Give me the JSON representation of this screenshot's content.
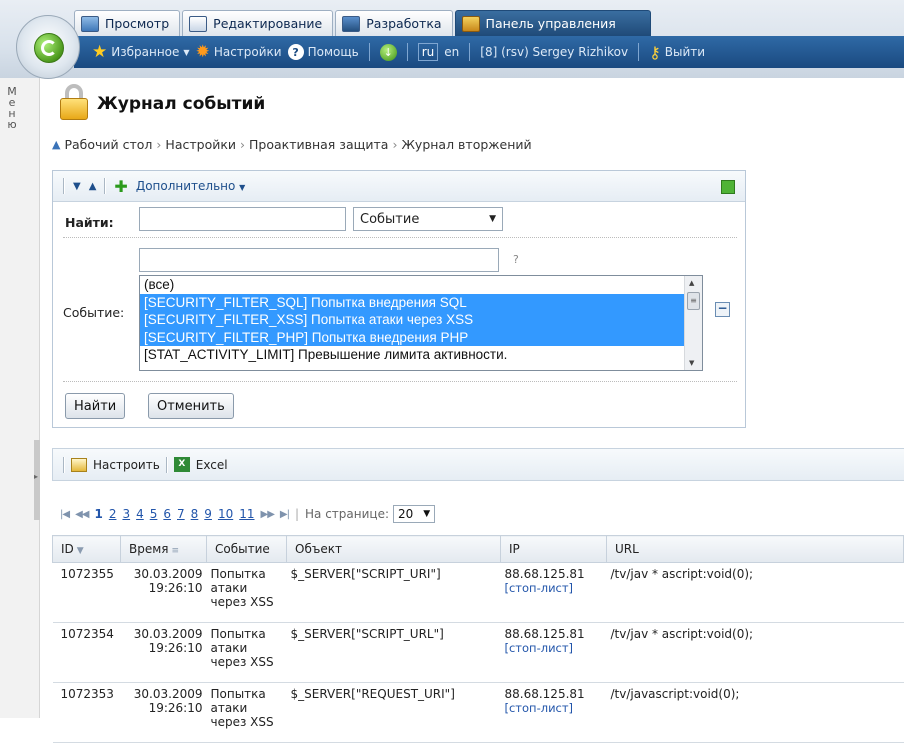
{
  "tabs": [
    {
      "label": "Просмотр",
      "icon": "view-icon"
    },
    {
      "label": "Редактирование",
      "icon": "edit-icon"
    },
    {
      "label": "Разработка",
      "icon": "develop-icon"
    },
    {
      "label": "Панель управления",
      "icon": "control-panel-icon"
    }
  ],
  "toolbar": {
    "favorites": "Избранное",
    "settings": "Настройки",
    "help": "Помощь",
    "lang_ru": "ru",
    "lang_en": "en",
    "user": "[8] (rsv) Sergey Rizhikov",
    "logout": "Выйти"
  },
  "side_menu": [
    "М",
    "е",
    "н",
    "ю"
  ],
  "page": {
    "title": "Журнал событий",
    "breadcrumb": [
      "Рабочий стол",
      "Настройки",
      "Проактивная защита",
      "Журнал вторжений"
    ]
  },
  "filter": {
    "more": "Дополнительно",
    "find_label": "Найти:",
    "find_value": "",
    "find_select": "Событие",
    "question": "?",
    "event_label": "Событие:",
    "options": [
      {
        "text": "(все)",
        "selected": false
      },
      {
        "text": "[SECURITY_FILTER_SQL] Попытка внедрения SQL",
        "selected": true
      },
      {
        "text": "[SECURITY_FILTER_XSS] Попытка атаки через XSS",
        "selected": true
      },
      {
        "text": "[SECURITY_FILTER_PHP] Попытка внедрения PHP",
        "selected": true
      },
      {
        "text": "[STAT_ACTIVITY_LIMIT] Превышение лимита активности.",
        "selected": false
      }
    ],
    "find_button": "Найти",
    "cancel_button": "Отменить"
  },
  "list_toolbar": {
    "configure": "Настроить",
    "excel": "Excel"
  },
  "pager": {
    "pages": [
      "1",
      "2",
      "3",
      "4",
      "5",
      "6",
      "7",
      "8",
      "9",
      "10",
      "11"
    ],
    "current": "1",
    "per_page_label": "На странице:",
    "per_page": "20"
  },
  "table": {
    "columns": [
      "ID",
      "Время",
      "Событие",
      "Объект",
      "IP",
      "URL"
    ],
    "rows": [
      {
        "id": "1072355",
        "date": "30.03.2009",
        "time": "19:26:10",
        "event": [
          "Попытка",
          "атаки",
          "через XSS"
        ],
        "object": "$_SERVER[\"SCRIPT_URI\"]",
        "ip": "88.68.125.81",
        "stop": "[стоп-лист]",
        "url": "/tv/jav * ascript:void(0);"
      },
      {
        "id": "1072354",
        "date": "30.03.2009",
        "time": "19:26:10",
        "event": [
          "Попытка",
          "атаки",
          "через XSS"
        ],
        "object": "$_SERVER[\"SCRIPT_URL\"]",
        "ip": "88.68.125.81",
        "stop": "[стоп-лист]",
        "url": "/tv/jav * ascript:void(0);"
      },
      {
        "id": "1072353",
        "date": "30.03.2009",
        "time": "19:26:10",
        "event": [
          "Попытка",
          "атаки",
          "через XSS"
        ],
        "object": "$_SERVER[\"REQUEST_URI\"]",
        "ip": "88.68.125.81",
        "stop": "[стоп-лист]",
        "url": "/tv/javascript:void(0);"
      }
    ]
  },
  "colors": {
    "selection": "#3399ff",
    "toolbar": "#1a4a80",
    "active_tab": "#2a5d92"
  }
}
